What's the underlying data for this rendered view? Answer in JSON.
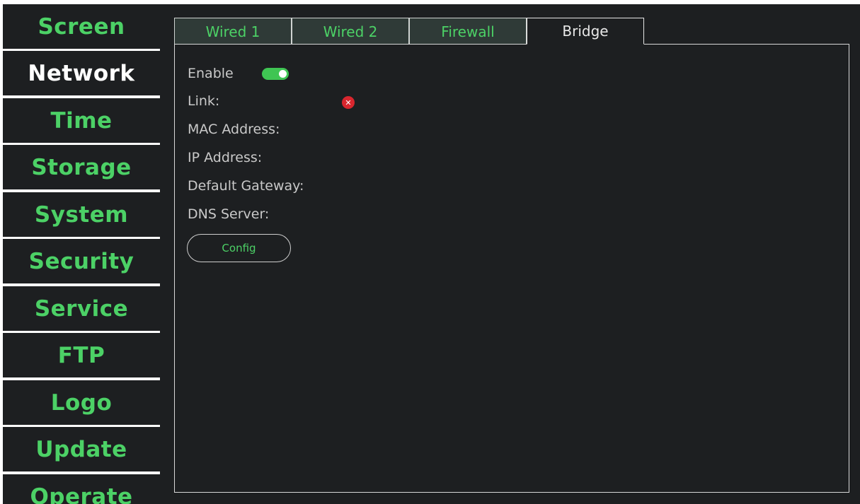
{
  "sidebar": {
    "items": [
      {
        "label": "Screen"
      },
      {
        "label": "Network"
      },
      {
        "label": "Time"
      },
      {
        "label": "Storage"
      },
      {
        "label": "System"
      },
      {
        "label": "Security"
      },
      {
        "label": "Service"
      },
      {
        "label": "FTP"
      },
      {
        "label": "Logo"
      },
      {
        "label": "Update"
      },
      {
        "label": "Operate"
      }
    ],
    "active": "Network"
  },
  "tabs": [
    {
      "label": "Wired 1"
    },
    {
      "label": "Wired 2"
    },
    {
      "label": "Firewall"
    },
    {
      "label": "Bridge"
    }
  ],
  "active_tab": "Bridge",
  "bridge": {
    "enable_label": "Enable",
    "enable_state": true,
    "link_label": "Link:",
    "link_status_icon": "error-x-icon",
    "mac_label": "MAC Address:",
    "ip_label": "IP Address:",
    "gateway_label": "Default Gateway:",
    "dns_label": "DNS Server:",
    "config_button": "Config",
    "error_glyph": "✕"
  },
  "colors": {
    "accent": "#4cd166",
    "background": "#1d1f21",
    "toggle_on": "#3fc553",
    "error": "#d9262e"
  }
}
